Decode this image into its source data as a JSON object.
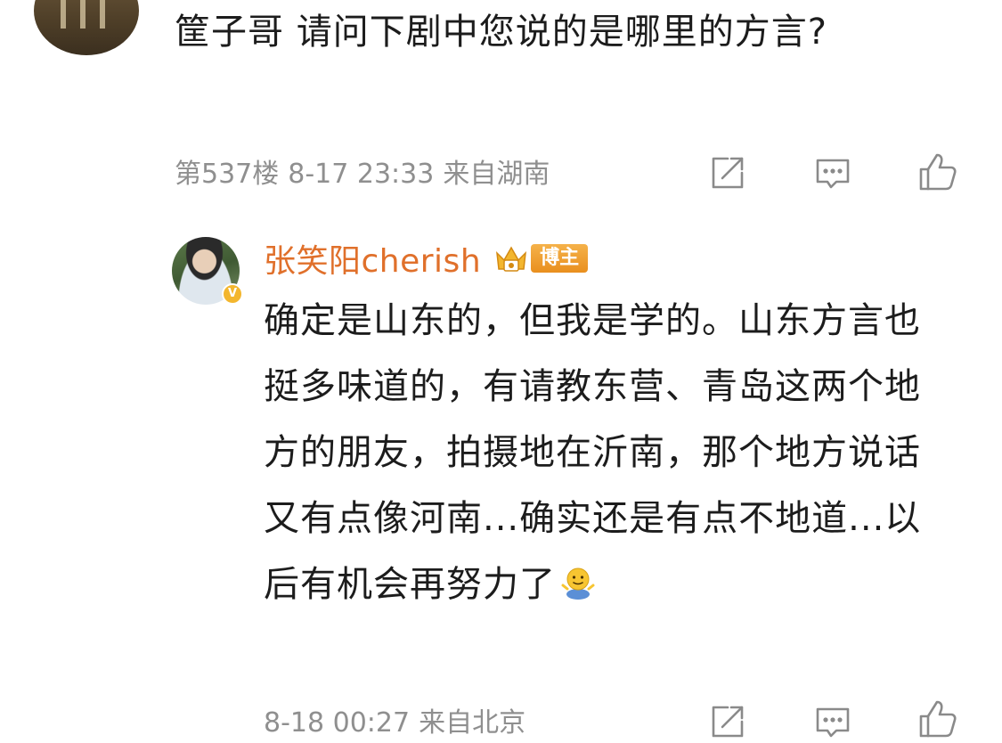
{
  "parent_comment": {
    "text": "筐子哥 请问下剧中您说的是哪里的方言?",
    "floor": "第537楼",
    "time": "8-17 23:33",
    "location": "来自湖南"
  },
  "reply": {
    "author": "张笑阳cherish",
    "badge": "博主",
    "verified_mark": "V",
    "text": "确定是山东的，但我是学的。山东方言也挺多味道的，有请教东营、青岛这两个地方的朋友，拍摄地在沂南，那个地方说话又有点像河南...确实还是有点不地道...以后有机会再努力了",
    "emoji": "shrug-emoji",
    "time": "8-18 00:27",
    "location": "来自北京"
  },
  "icons": {
    "share": "share-icon",
    "comment": "comment-icon",
    "like": "like-icon"
  },
  "colors": {
    "username": "#e0702b",
    "meta_text": "#8f8f8f",
    "badge": "#e98f1e",
    "verified": "#f3b62e"
  }
}
